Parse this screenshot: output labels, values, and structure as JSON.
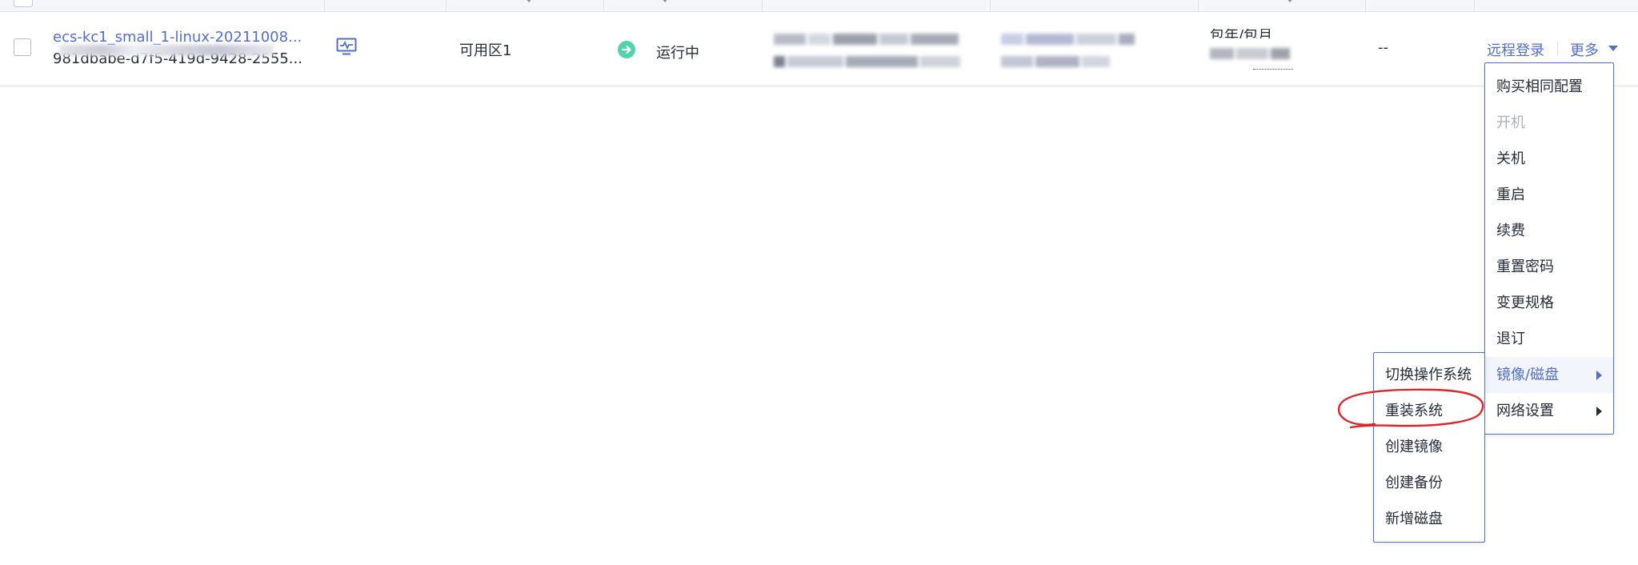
{
  "row": {
    "instance_name": "ecs-kc1_small_1-linux-20211008...",
    "instance_id": "981dbabe-d7f5-419d-9428-2555...",
    "zone": "可用区1",
    "status": "运行中",
    "billing": "包年/包月",
    "enterprise_project": "--"
  },
  "actions": {
    "remote_login": "远程登录",
    "more": "更多"
  },
  "more_menu": {
    "items": [
      {
        "label": "购买相同配置"
      },
      {
        "label": "开机"
      },
      {
        "label": "关机"
      },
      {
        "label": "重启"
      },
      {
        "label": "续费"
      },
      {
        "label": "重置密码"
      },
      {
        "label": "变更规格"
      },
      {
        "label": "退订"
      },
      {
        "label": "镜像/磁盘"
      },
      {
        "label": "网络设置"
      }
    ]
  },
  "submenu": {
    "items": [
      {
        "label": "切换操作系统"
      },
      {
        "label": "重装系统"
      },
      {
        "label": "创建镜像"
      },
      {
        "label": "创建备份"
      },
      {
        "label": "新增磁盘"
      }
    ]
  },
  "icons": {
    "monitor": "monitor-icon",
    "status": "running-status-icon"
  },
  "colors": {
    "link": "#526ecc",
    "running": "#50d4ab",
    "annotation": "#e0242a"
  }
}
